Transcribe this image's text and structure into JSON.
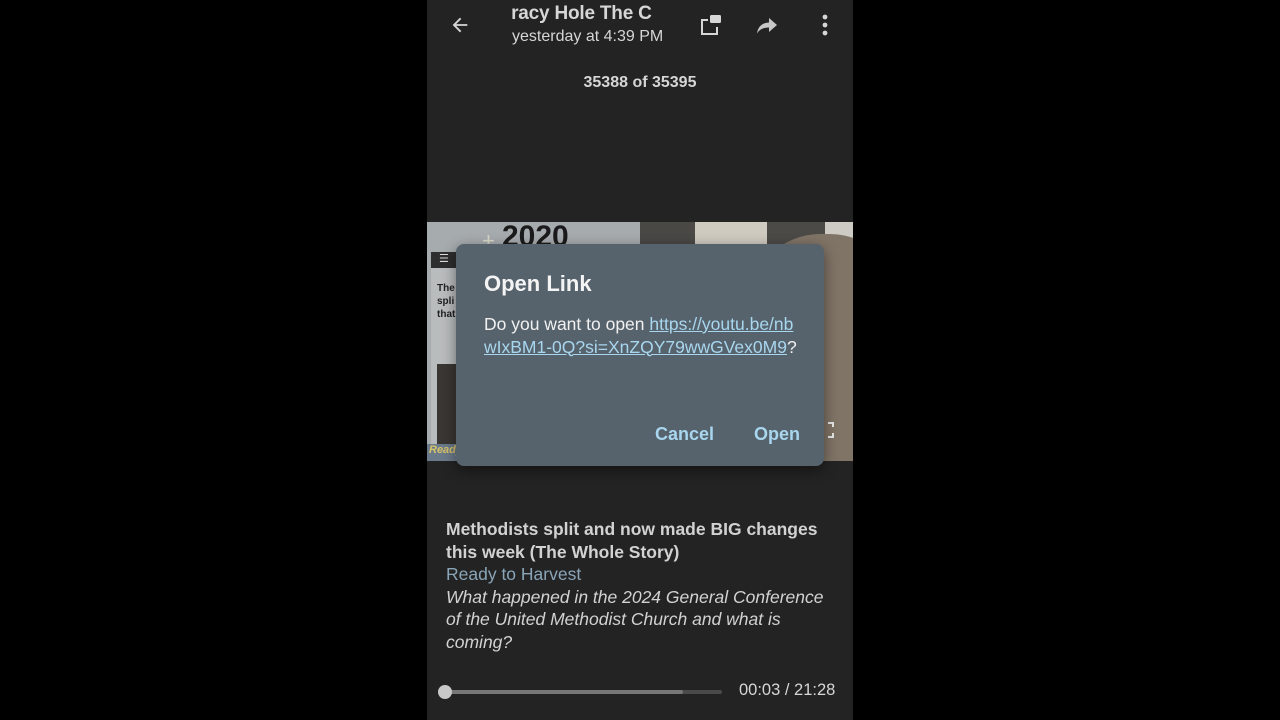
{
  "header": {
    "title": "iracy Hole   The C",
    "subtitle": "yesterday at 4:39 PM",
    "back_icon": "arrow-left-icon",
    "open_external_icon": "open-in-new-window-icon",
    "share_icon": "forward-share-icon",
    "more_icon": "more-vertical-icon"
  },
  "counter": {
    "text": "35388 of 35395"
  },
  "thumbnail": {
    "year_text": "2020",
    "menu_glyph": "☰",
    "headline_partial": "The\nspli\nthat",
    "channel_badge": "Ready",
    "fullscreen_icon": "fullscreen-icon"
  },
  "dialog": {
    "title": "Open Link",
    "body_prefix": "Do you want to open ",
    "url": "https://youtu.be/nbwIxBM1-0Q?si=XnZQY79wwGVex0M9",
    "body_suffix": "?",
    "cancel_label": "Cancel",
    "open_label": "Open"
  },
  "video": {
    "title": "Methodists split and now made BIG changes this week (The Whole Story)",
    "channel": "Ready to Harvest",
    "description": "What happened in the 2024 General Conference of the United Methodist Church and what is coming?"
  },
  "player": {
    "time_text": "00:03 / 21:28",
    "current_seconds": 3,
    "duration_seconds": 1288,
    "buffered_fraction": 0.86
  },
  "colors": {
    "background": "#232323",
    "dialog_bg": "#56626c",
    "link": "#a8d6ee",
    "channel": "#8aa5b8"
  }
}
